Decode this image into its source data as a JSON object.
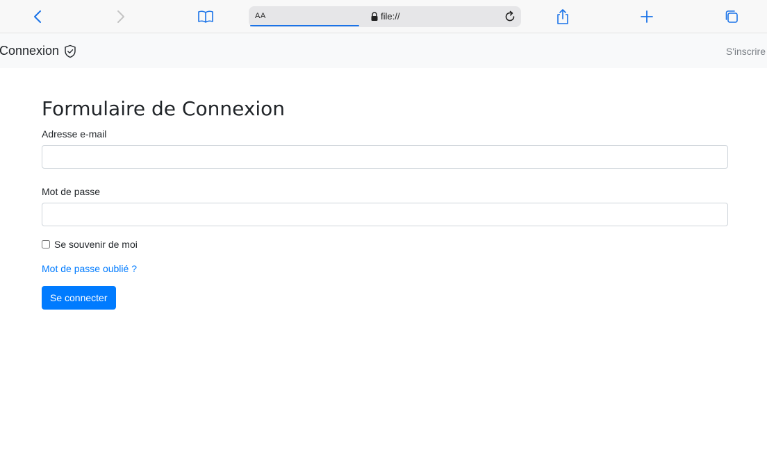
{
  "browser": {
    "aa_label": "AA",
    "url": "file://",
    "page_load_progress": 0.4,
    "icons": {
      "back": "chevron-left-icon",
      "forward": "chevron-right-icon",
      "bookmarks": "book-icon",
      "lock": "lock-icon",
      "reload": "reload-icon",
      "share": "share-icon",
      "new_tab": "plus-icon",
      "tabs": "tabs-icon"
    },
    "accent_color": "#1a73e8"
  },
  "navbar": {
    "brand": "Connexion",
    "brand_icon": "shield-check-icon",
    "register_link": "S'inscrire"
  },
  "form": {
    "title": "Formulaire de Connexion",
    "email_label": "Adresse e-mail",
    "email_value": "",
    "password_label": "Mot de passe",
    "password_value": "",
    "remember_label": "Se souvenir de moi",
    "remember_checked": false,
    "forgot_link": "Mot de passe oublié ?",
    "submit_label": "Se connecter",
    "primary_color": "#007bff"
  }
}
